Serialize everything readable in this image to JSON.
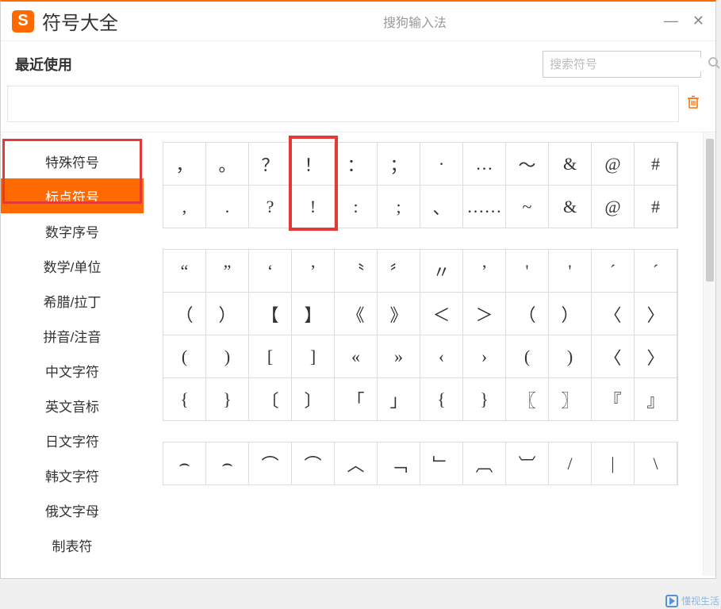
{
  "header": {
    "app_icon_letter": "S",
    "title": "符号大全",
    "subtitle": "搜狗输入法"
  },
  "recent": {
    "label": "最近使用"
  },
  "search": {
    "placeholder": "搜索符号"
  },
  "sidebar": {
    "items": [
      {
        "label": "特殊符号"
      },
      {
        "label": "标点符号",
        "active": true
      },
      {
        "label": "数字序号"
      },
      {
        "label": "数学/单位"
      },
      {
        "label": "希腊/拉丁"
      },
      {
        "label": "拼音/注音"
      },
      {
        "label": "中文字符"
      },
      {
        "label": "英文音标"
      },
      {
        "label": "日文字符"
      },
      {
        "label": "韩文字符"
      },
      {
        "label": "俄文字母"
      },
      {
        "label": "制表符"
      }
    ]
  },
  "symbol_blocks": [
    {
      "rows": [
        [
          "，",
          "。",
          "？",
          "！",
          "：",
          "；",
          "·",
          "…",
          "～",
          "&",
          "@",
          "#"
        ],
        [
          ",",
          ".",
          "?",
          "!",
          ":",
          ";",
          "、",
          "……",
          "~",
          "&",
          "@",
          "#"
        ]
      ]
    },
    {
      "rows": [
        [
          "“",
          "”",
          "‘",
          "’",
          "〝",
          "〞",
          "〃",
          "’",
          "'",
          "'",
          "´",
          "ˊ"
        ],
        [
          "（",
          "）",
          "【",
          "】",
          "《",
          "》",
          "＜",
          "＞",
          "（",
          "）",
          "〈",
          "〉"
        ],
        [
          "(",
          ")",
          "[",
          "]",
          "«",
          "»",
          "‹",
          "›",
          "(",
          ")",
          "〈",
          "〉"
        ],
        [
          "{",
          "}",
          "〔",
          "〕",
          "「",
          "」",
          "{",
          "}",
          "〖",
          "〗",
          "『",
          "』"
        ]
      ]
    },
    {
      "rows": [
        [
          "⌢",
          "⌢",
          "⌒",
          "⌒",
          "︿",
          "﹁",
          "﹂",
          "︹",
          "︺",
          "/",
          "|",
          "\\"
        ]
      ]
    }
  ],
  "watermark": {
    "text": "懂视生活"
  }
}
